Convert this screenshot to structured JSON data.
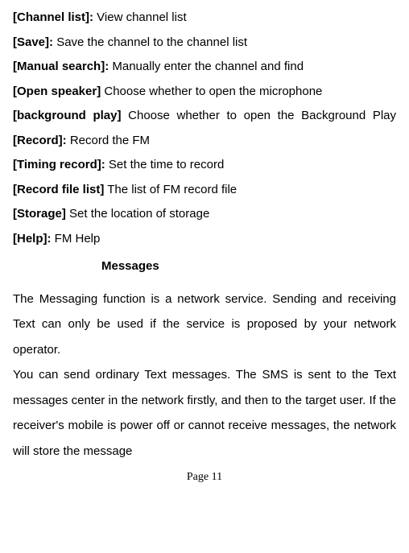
{
  "entries": [
    {
      "label": "[Channel list]:",
      "desc": "View channel list"
    },
    {
      "label": "[Save]:",
      "desc": "Save the channel to the channel list"
    },
    {
      "label": "[Manual search]:",
      "desc": "Manually enter the channel and find"
    },
    {
      "label": "[Open speaker]",
      "desc": "Choose whether to open the microphone"
    },
    {
      "label": "[background play]",
      "desc": "Choose whether to open the Background Play",
      "justified": true
    },
    {
      "label": "[Record]:",
      "desc": "Record the FM"
    },
    {
      "label": "[Timing record]:",
      "desc": "Set the time to record"
    },
    {
      "label": "[Record file list]",
      "desc": "  The list of FM record file"
    },
    {
      "label": "[Storage]",
      "desc": "Set the location of storage"
    },
    {
      "label": "[Help]:",
      "desc": "FM Help"
    }
  ],
  "heading": "Messages",
  "paragraphs": [
    "The Messaging function is a network service. Sending and receiving Text can only be used if the service is proposed by your network operator.",
    "You can send ordinary Text messages. The SMS is sent to the Text messages center in the network firstly, and then to the target user. If the receiver's mobile is power off or cannot receive messages, the network will store the message"
  ],
  "pageNumber": "Page 11"
}
